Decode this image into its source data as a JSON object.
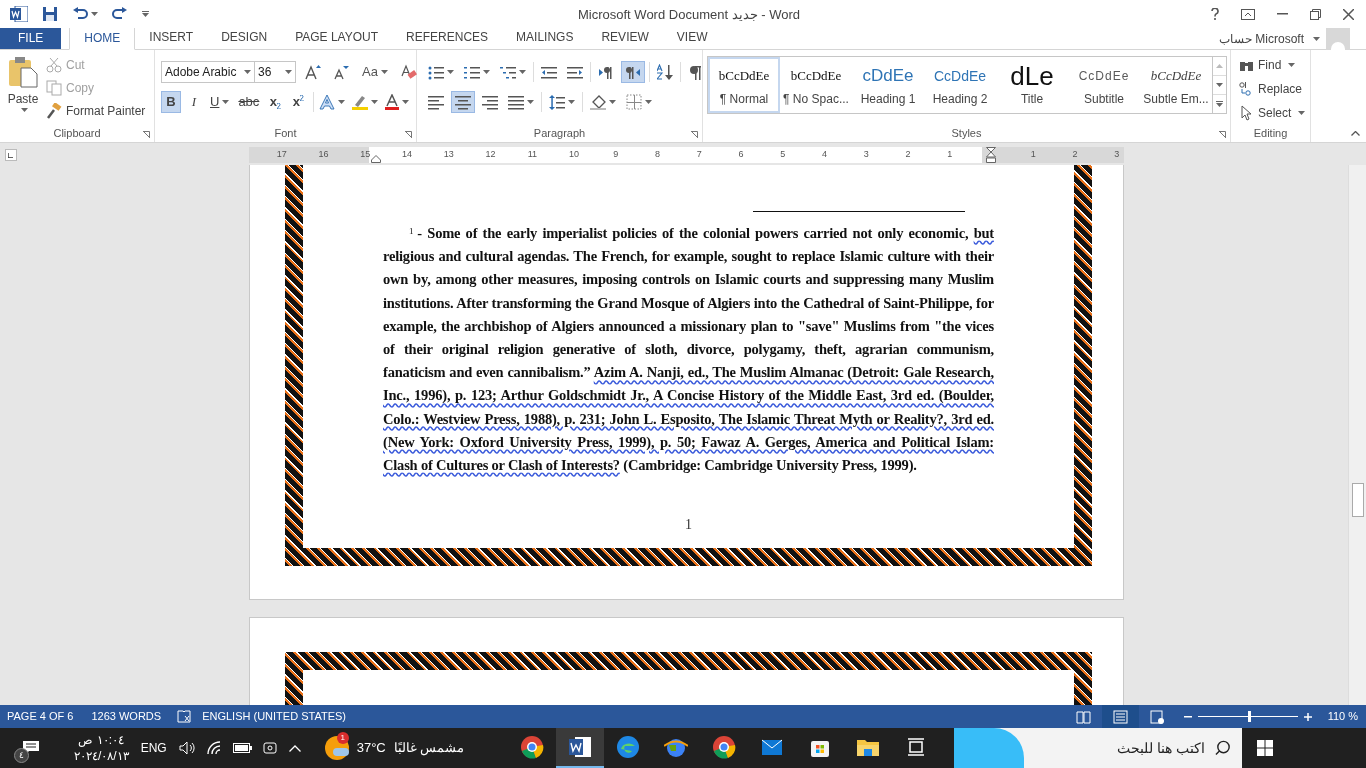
{
  "window": {
    "title": "Microsoft Word Document جديد - Word",
    "account": "حساب Microsoft"
  },
  "tabs": [
    {
      "label": "FILE",
      "kind": "file",
      "selected": false
    },
    {
      "label": "HOME",
      "kind": "tab",
      "selected": true
    },
    {
      "label": "INSERT",
      "kind": "tab",
      "selected": false
    },
    {
      "label": "DESIGN",
      "kind": "tab",
      "selected": false
    },
    {
      "label": "PAGE LAYOUT",
      "kind": "tab",
      "selected": false
    },
    {
      "label": "REFERENCES",
      "kind": "tab",
      "selected": false
    },
    {
      "label": "MAILINGS",
      "kind": "tab",
      "selected": false
    },
    {
      "label": "REVIEW",
      "kind": "tab",
      "selected": false
    },
    {
      "label": "VIEW",
      "kind": "tab",
      "selected": false
    }
  ],
  "clipboard": {
    "label": "Clipboard",
    "paste": "Paste",
    "items": [
      {
        "kind": "cut",
        "label": "Cut",
        "disabled": true
      },
      {
        "kind": "copy",
        "label": "Copy",
        "disabled": true
      },
      {
        "kind": "painter",
        "label": "Format Painter",
        "disabled": false
      }
    ]
  },
  "font": {
    "label": "Font",
    "name": "Adobe Arabic",
    "size": "36",
    "case_glyph": "Aa",
    "buttons": [
      {
        "glyph": "B",
        "kind": "bold",
        "selected": true
      },
      {
        "glyph": "I",
        "kind": "italic",
        "selected": false
      },
      {
        "glyph": "U",
        "kind": "underline",
        "selected": false
      },
      {
        "glyph": "abc",
        "kind": "strike",
        "selected": false
      },
      {
        "glyph": "x",
        "kind": "sub",
        "selected": false
      },
      {
        "glyph": "x",
        "kind": "sup",
        "selected": false
      }
    ]
  },
  "paragraph": {
    "label": "Paragraph",
    "top": [
      {
        "kind": "bullets",
        "selected": false
      },
      {
        "kind": "numbering",
        "selected": false
      },
      {
        "kind": "multilevel",
        "selected": false
      },
      {
        "kind": "outdent",
        "selected": false
      },
      {
        "kind": "indent",
        "selected": false
      },
      {
        "kind": "ltr",
        "selected": false
      },
      {
        "kind": "rtl",
        "selected": true
      },
      {
        "kind": "sort",
        "selected": false
      },
      {
        "kind": "pilcrow",
        "selected": false
      }
    ],
    "bottom": [
      {
        "kind": "align-left",
        "selected": false
      },
      {
        "kind": "align-center",
        "selected": true
      },
      {
        "kind": "align-right",
        "selected": false
      },
      {
        "kind": "justify",
        "selected": false
      },
      {
        "kind": "spacing",
        "selected": false
      },
      {
        "kind": "shading",
        "selected": false
      },
      {
        "kind": "borders",
        "selected": false
      }
    ]
  },
  "styles": {
    "label": "Styles",
    "items": [
      {
        "kind": "normal",
        "preview": "bCcDdEe",
        "label": "¶ Normal",
        "selected": true
      },
      {
        "kind": "nospacing",
        "preview": "bCcDdEe",
        "label": "¶ No Spac...",
        "selected": false
      },
      {
        "kind": "heading1",
        "preview": "cDdEe",
        "label": "Heading 1",
        "selected": false
      },
      {
        "kind": "heading2",
        "preview": "CcDdEe",
        "label": "Heading 2",
        "selected": false
      },
      {
        "kind": "title",
        "preview": "dLe",
        "label": "Title",
        "selected": false
      },
      {
        "kind": "subtitle",
        "preview": "CcDdEe",
        "label": "Subtitle",
        "selected": false
      },
      {
        "kind": "emphasis",
        "preview": "bCcDdEe",
        "label": "Subtle Em...",
        "selected": false
      }
    ]
  },
  "editing": {
    "label": "Editing",
    "items": [
      {
        "kind": "find",
        "label": "Find"
      },
      {
        "kind": "replace",
        "label": "Replace"
      },
      {
        "kind": "select",
        "label": "Select"
      }
    ]
  },
  "ruler": {
    "marks": [
      "17",
      "16",
      "15",
      "14",
      "13",
      "12",
      "11",
      "10",
      "9",
      "8",
      "7",
      "6",
      "5",
      "4",
      "3",
      "2",
      "1",
      "1",
      "2",
      "3"
    ]
  },
  "footnote": {
    "number": "1",
    "segments": [
      {
        "text": "- Some of the early imperialist policies of the colonial powers carried not only economic, ",
        "underlined": false
      },
      {
        "text": "but",
        "underlined": true
      },
      {
        "text": " religious and cultural agendas. The French, for example, sought to replace Islamic culture with their own by, among other measures, imposing controls on Islamic courts and suppressing many Muslim institutions. After transforming the Grand Mosque of Algiers into the Cathedral of Saint-Philippe, for example, the archbishop of Algiers announced a missionary plan to \"save\" Muslims from \"the vices of their original religion generative of sloth, divorce, polygamy, theft, agrarian communism, fanaticism and even cannibalism.” ",
        "underlined": false
      },
      {
        "text": "Azim A. Nanji, ed., The Muslim Almanac (Detroit: Gale Research, Inc., 1996), p. 123; Arthur Goldschmidt Jr., A Concise History of the Middle East, 3rd ed. (Boulder, Colo.: Westview Press, 1988), p. 231; John L. Esposito, The Islamic Threat Myth or Reality?, 3rd ed. (New York: Oxford University Press, 1999), p. 50; Fawaz A. Gerges, America and Political Islam: Clash of Cultures or Clash of Interests?",
        "underlined": true
      },
      {
        "text": " (Cambridge: Cambridge University Press, 1999).",
        "underlined": false
      }
    ]
  },
  "page_number": "1",
  "status_bar": {
    "page": "PAGE 4 OF 6",
    "words": "1263 WORDS",
    "language": "ENGLISH (UNITED STATES)",
    "views": [
      {
        "kind": "read",
        "selected": false
      },
      {
        "kind": "print",
        "selected": true
      },
      {
        "kind": "web",
        "selected": false
      }
    ],
    "zoom": {
      "level": 0.52,
      "reading": "110 %"
    }
  },
  "taskbar": {
    "notifications": "٤",
    "time": "١٠:٠٤ ص",
    "date": "٢٠٢٤/٠٨/١٣",
    "language": "ENG",
    "weather": {
      "badge": "1",
      "temperature": "37°C",
      "condition": "مشمس غالبًا"
    },
    "apps": [
      {
        "kind": "chrome-alt",
        "active": false
      },
      {
        "kind": "word",
        "active": true
      },
      {
        "kind": "edge",
        "active": false
      },
      {
        "kind": "globe",
        "active": false
      },
      {
        "kind": "chrome",
        "active": false
      },
      {
        "kind": "mail",
        "active": false
      },
      {
        "kind": "store",
        "active": false
      },
      {
        "kind": "folder",
        "active": false
      },
      {
        "kind": "taskview",
        "active": false
      }
    ],
    "search": {
      "placeholder": "اكتب هنا للبحث"
    }
  }
}
